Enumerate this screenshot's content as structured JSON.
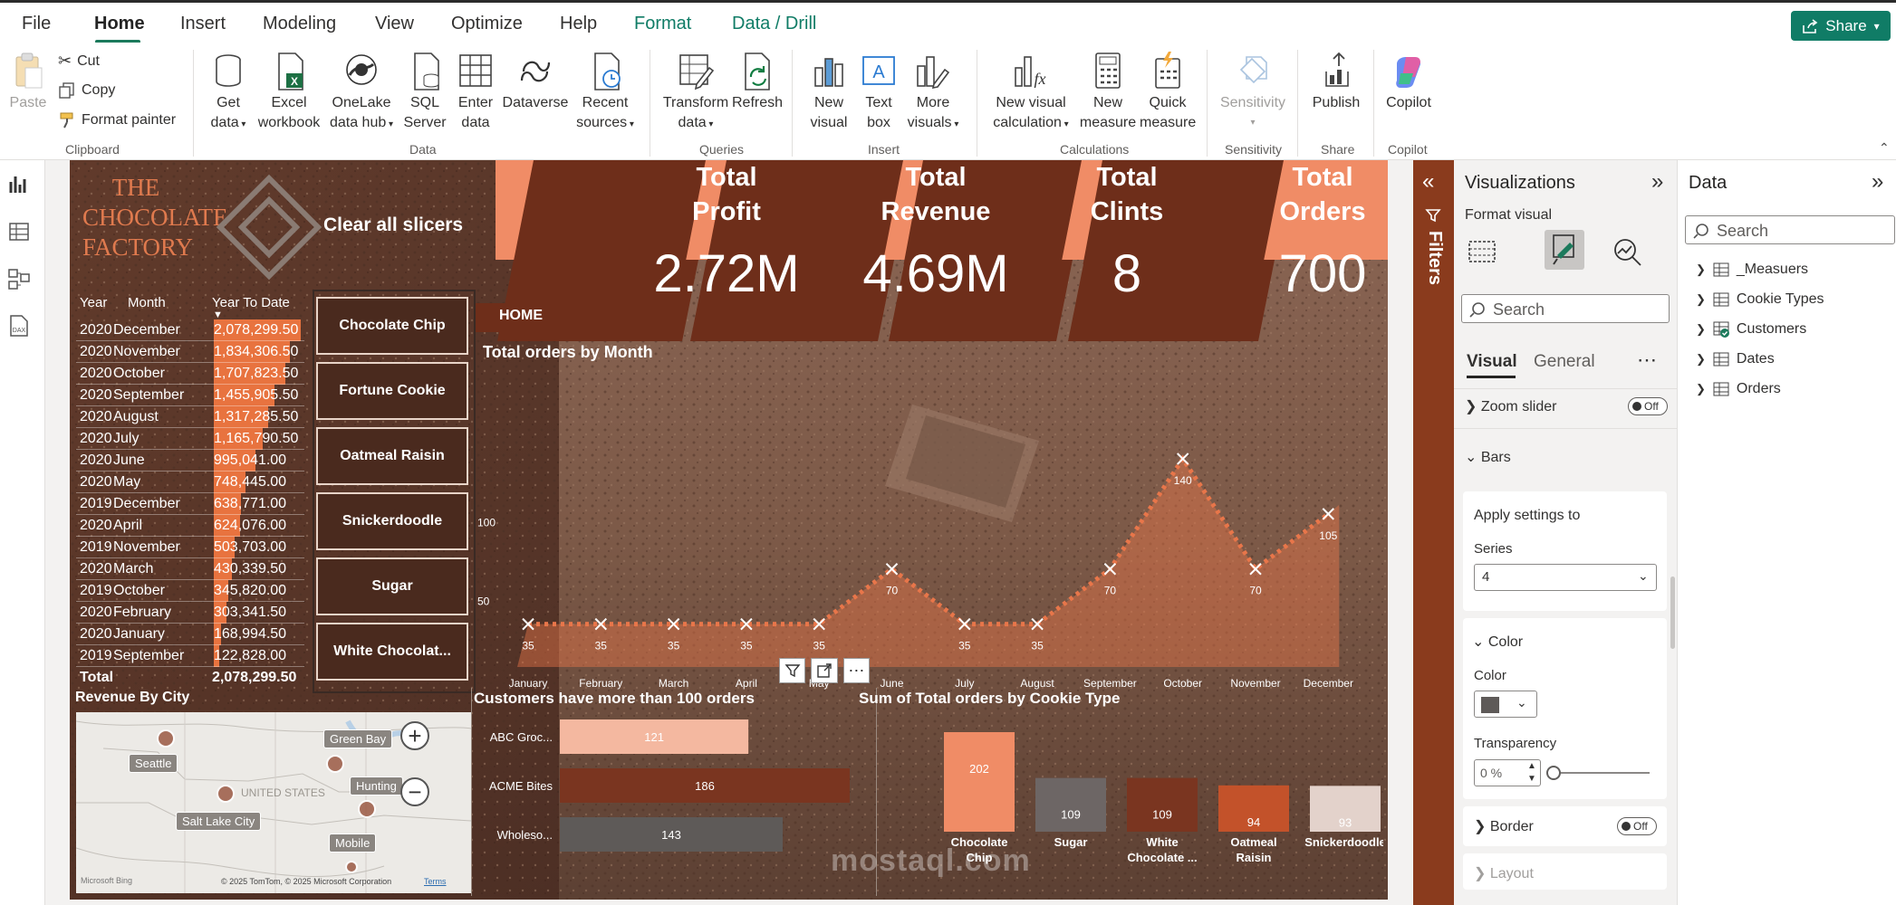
{
  "menu": {
    "items": [
      "File",
      "Home",
      "Insert",
      "Modeling",
      "View",
      "Optimize",
      "Help",
      "Format",
      "Data / Drill"
    ],
    "active": "Home",
    "share_label": "Share"
  },
  "ribbon": {
    "clipboard": {
      "paste": "Paste",
      "cut": "Cut",
      "copy": "Copy",
      "format_painter": "Format painter",
      "group": "Clipboard"
    },
    "data": {
      "get_data": [
        "Get",
        "data"
      ],
      "excel": [
        "Excel",
        "workbook"
      ],
      "onelake": [
        "OneLake",
        "data hub"
      ],
      "sql": [
        "SQL",
        "Server"
      ],
      "enter": [
        "Enter",
        "data"
      ],
      "dataverse": "Dataverse",
      "recent": [
        "Recent",
        "sources"
      ],
      "group": "Data"
    },
    "queries": {
      "transform": [
        "Transform",
        "data"
      ],
      "refresh": "Refresh",
      "group": "Queries"
    },
    "insert": {
      "new_visual": [
        "New",
        "visual"
      ],
      "text_box": [
        "Text",
        "box"
      ],
      "more_visuals": [
        "More",
        "visuals"
      ],
      "group": "Insert"
    },
    "calculations": {
      "new_visual_calc": [
        "New visual",
        "calculation"
      ],
      "new_measure": [
        "New",
        "measure"
      ],
      "quick_measure": [
        "Quick",
        "measure"
      ],
      "group": "Calculations"
    },
    "sensitivity": {
      "label": "Sensitivity",
      "group": "Sensitivity"
    },
    "share": {
      "publish": "Publish",
      "group": "Share"
    },
    "copilot": {
      "label": "Copilot",
      "group": "Copilot"
    }
  },
  "report": {
    "logo": [
      "THE",
      "CHOCOLATE",
      "FACTORY"
    ],
    "clear_slicers": "Clear all slicers",
    "home_button": "HOME",
    "kpis": [
      {
        "title": [
          "Total",
          "Profit"
        ],
        "value": "2.72M"
      },
      {
        "title": [
          "Total",
          "Revenue"
        ],
        "value": "4.69M"
      },
      {
        "title": [
          "Total",
          "Clints"
        ],
        "value": "8"
      },
      {
        "title": [
          "Total",
          "Orders"
        ],
        "value": "700"
      }
    ],
    "table": {
      "headers": [
        "Year",
        "Month",
        "Year To Date"
      ],
      "rows": [
        {
          "year": "2020",
          "month": "December",
          "ytd": "2,078,299.50",
          "fill": 1.0
        },
        {
          "year": "2020",
          "month": "November",
          "ytd": "1,834,306.50",
          "fill": 0.88
        },
        {
          "year": "2020",
          "month": "October",
          "ytd": "1,707,823.50",
          "fill": 0.82
        },
        {
          "year": "2020",
          "month": "September",
          "ytd": "1,455,905.50",
          "fill": 0.7
        },
        {
          "year": "2020",
          "month": "August",
          "ytd": "1,317,285.50",
          "fill": 0.63
        },
        {
          "year": "2020",
          "month": "July",
          "ytd": "1,165,790.50",
          "fill": 0.56
        },
        {
          "year": "2020",
          "month": "June",
          "ytd": "995,041.00",
          "fill": 0.48
        },
        {
          "year": "2020",
          "month": "May",
          "ytd": "748,445.00",
          "fill": 0.36
        },
        {
          "year": "2019",
          "month": "December",
          "ytd": "638,771.00",
          "fill": 0.31
        },
        {
          "year": "2020",
          "month": "April",
          "ytd": "624,076.00",
          "fill": 0.3
        },
        {
          "year": "2019",
          "month": "November",
          "ytd": "503,703.00",
          "fill": 0.24
        },
        {
          "year": "2020",
          "month": "March",
          "ytd": "430,339.50",
          "fill": 0.21
        },
        {
          "year": "2019",
          "month": "October",
          "ytd": "345,820.00",
          "fill": 0.17
        },
        {
          "year": "2020",
          "month": "February",
          "ytd": "303,341.50",
          "fill": 0.15
        },
        {
          "year": "2020",
          "month": "January",
          "ytd": "168,994.50",
          "fill": 0.08
        },
        {
          "year": "2019",
          "month": "September",
          "ytd": "122,828.00",
          "fill": 0.06
        }
      ],
      "total_label": "Total",
      "total_value": "2,078,299.50"
    },
    "slicers": [
      "Chocolate Chip",
      "Fortune Cookie",
      "Oatmeal Raisin",
      "Snickerdoodle",
      "Sugar",
      "White Chocolat..."
    ],
    "map": {
      "title": "Revenue By City",
      "labels": [
        "Seattle",
        "Salt Lake City",
        "Green Bay",
        "Hunting",
        "Mobile",
        "UNITED STATES"
      ],
      "attribution": "© 2025 TomTom, © 2025 Microsoft Corporation",
      "terms": "Terms",
      "bing": "Microsoft Bing"
    },
    "bar_title": "Customers have more than 100 orders",
    "col_title": "Sum of Total orders by Cookie Type",
    "line_title": "Total orders by Month",
    "watermark": "mostaql.com"
  },
  "chart_data": [
    {
      "type": "area",
      "title": "Total orders by Month",
      "categories": [
        "January",
        "February",
        "March",
        "April",
        "May",
        "June",
        "July",
        "August",
        "September",
        "October",
        "November",
        "December"
      ],
      "values": [
        35,
        35,
        35,
        35,
        35,
        70,
        35,
        35,
        70,
        140,
        70,
        105
      ],
      "yticks": [
        50,
        100
      ],
      "ylim": [
        25,
        150
      ],
      "hidden_label_index": 4
    },
    {
      "type": "bar",
      "title": "Customers have more than 100 orders",
      "categories": [
        "ABC Groc...",
        "ACME Bites",
        "Wholeso..."
      ],
      "values": [
        121,
        186,
        143
      ],
      "colors": [
        "#f4b8a0",
        "#7a3520",
        "#5e5a58"
      ],
      "xlim": [
        0,
        186
      ]
    },
    {
      "type": "bar",
      "title": "Sum of Total orders by Cookie Type",
      "categories": [
        "Chocolate Chip",
        "Sugar",
        "White Chocolate ...",
        "Oatmeal Raisin",
        "Snickerdoodle"
      ],
      "values": [
        202,
        109,
        109,
        94,
        93
      ],
      "colors": [
        "#f08c66",
        "#6d6665",
        "#7a3520",
        "#c3522a",
        "#e3d2cb"
      ],
      "ylim": [
        0,
        202
      ]
    }
  ],
  "filters_label": "Filters",
  "visualizations": {
    "title": "Visualizations",
    "format_visual": "Format visual",
    "search": "Search",
    "tabs": [
      "Visual",
      "General"
    ],
    "zoom_slider": "Zoom slider",
    "toggle_off": "Off",
    "bars": "Bars",
    "apply_settings_to": "Apply settings to",
    "series_label": "Series",
    "series_value": "4",
    "color_section": "Color",
    "color_label": "Color",
    "transparency_label": "Transparency",
    "transparency_value": "0 %",
    "border": "Border",
    "layout": "Layout"
  },
  "data_pane": {
    "title": "Data",
    "search": "Search",
    "tables": [
      "_Measuers",
      "Cookie Types",
      "Customers",
      "Dates",
      "Orders"
    ]
  }
}
